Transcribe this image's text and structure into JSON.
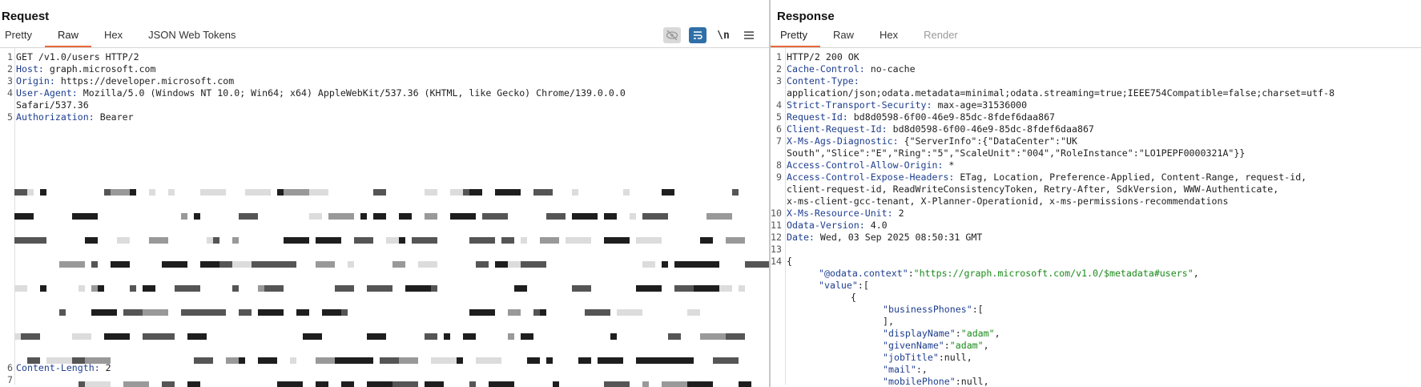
{
  "request": {
    "title": "Request",
    "tabs": [
      {
        "label": "Pretty",
        "active": false
      },
      {
        "label": "Raw",
        "active": true
      },
      {
        "label": "Hex",
        "active": false
      },
      {
        "label": "JSON Web Tokens",
        "active": false
      }
    ],
    "tools": [
      "eye-hidden-icon",
      "wrap-lines-icon",
      "newline-icon",
      "menu-icon"
    ],
    "newline_label": "\\n",
    "lines": [
      {
        "n": "1",
        "key": "",
        "value": "GET /v1.0/users HTTP/2"
      },
      {
        "n": "2",
        "key": "Host:",
        "value": " graph.microsoft.com"
      },
      {
        "n": "3",
        "key": "Origin:",
        "value": " https://developer.microsoft.com"
      },
      {
        "n": "4",
        "key": "User-Agent:",
        "value": " Mozilla/5.0 (Windows NT 10.0; Win64; x64) AppleWebKit/537.36 (KHTML, like Gecko) Chrome/139.0.0.0"
      },
      {
        "n": "",
        "key": "",
        "value": "Safari/537.36"
      },
      {
        "n": "5",
        "key": "Authorization:",
        "value": " Bearer"
      },
      {
        "n": "6",
        "key": "Content-Length:",
        "value": " 2"
      },
      {
        "n": "7",
        "key": "",
        "value": ""
      }
    ]
  },
  "response": {
    "title": "Response",
    "tabs": [
      {
        "label": "Pretty",
        "active": true
      },
      {
        "label": "Raw",
        "active": false
      },
      {
        "label": "Hex",
        "active": false
      },
      {
        "label": "Render",
        "active": false,
        "muted": true
      }
    ],
    "lines": [
      {
        "n": "1",
        "key": "",
        "value": "HTTP/2 200 OK"
      },
      {
        "n": "2",
        "key": "Cache-Control:",
        "value": " no-cache"
      },
      {
        "n": "3",
        "key": "Content-Type:",
        "value": ""
      },
      {
        "n": "",
        "key": "",
        "value": "application/json;odata.metadata=minimal;odata.streaming=true;IEEE754Compatible=false;charset=utf-8"
      },
      {
        "n": "4",
        "key": "Strict-Transport-Security:",
        "value": " max-age=31536000"
      },
      {
        "n": "5",
        "key": "Request-Id:",
        "value": " bd8d0598-6f00-46e9-85dc-8fdef6daa867"
      },
      {
        "n": "6",
        "key": "Client-Request-Id:",
        "value": " bd8d0598-6f00-46e9-85dc-8fdef6daa867"
      },
      {
        "n": "7",
        "key": "X-Ms-Ags-Diagnostic:",
        "value": " {\"ServerInfo\":{\"DataCenter\":\"UK"
      },
      {
        "n": "",
        "key": "",
        "value": "South\",\"Slice\":\"E\",\"Ring\":\"5\",\"ScaleUnit\":\"004\",\"RoleInstance\":\"LO1PEPF0000321A\"}}"
      },
      {
        "n": "8",
        "key": "Access-Control-Allow-Origin:",
        "value": " *"
      },
      {
        "n": "9",
        "key": "Access-Control-Expose-Headers:",
        "value": " ETag, Location, Preference-Applied, Content-Range, request-id,"
      },
      {
        "n": "",
        "key": "",
        "value": "client-request-id, ReadWriteConsistencyToken, Retry-After, SdkVersion, WWW-Authenticate,"
      },
      {
        "n": "",
        "key": "",
        "value": "x-ms-client-gcc-tenant, X-Planner-Operationid, x-ms-permissions-recommendations"
      },
      {
        "n": "10",
        "key": "X-Ms-Resource-Unit:",
        "value": " 2"
      },
      {
        "n": "11",
        "key": "Odata-Version:",
        "value": " 4.0"
      },
      {
        "n": "12",
        "key": "Date:",
        "value": " Wed, 03 Sep 2025 08:50:31 GMT"
      },
      {
        "n": "13",
        "key": "",
        "value": ""
      },
      {
        "n": "14",
        "key": "",
        "value": "{"
      }
    ],
    "json": [
      {
        "indent": 40,
        "key": "\"@odata.context\"",
        "sep": ":",
        "val": "\"https://graph.microsoft.com/v1.0/$metadata#users\"",
        "tail": ","
      },
      {
        "indent": 40,
        "key": "\"value\"",
        "sep": ":[",
        "val": "",
        "tail": ""
      },
      {
        "indent": 80,
        "key": "",
        "sep": "{",
        "val": "",
        "tail": ""
      },
      {
        "indent": 120,
        "key": "\"businessPhones\"",
        "sep": ":[",
        "val": "",
        "tail": ""
      },
      {
        "indent": 120,
        "key": "",
        "sep": "],",
        "val": "",
        "tail": ""
      },
      {
        "indent": 120,
        "key": "\"displayName\"",
        "sep": ":",
        "val": "\"adam\"",
        "tail": ","
      },
      {
        "indent": 120,
        "key": "\"givenName\"",
        "sep": ":",
        "val": "\"adam\"",
        "tail": ","
      },
      {
        "indent": 120,
        "key": "\"jobTitle\"",
        "sep": ":null,",
        "val": "",
        "tail": ""
      },
      {
        "indent": 120,
        "key": "\"mail\"",
        "sep": ":",
        "val": "",
        "tail": ","
      },
      {
        "indent": 120,
        "key": "\"mobilePhone\"",
        "sep": ":null,",
        "val": "",
        "tail": ""
      }
    ]
  }
}
